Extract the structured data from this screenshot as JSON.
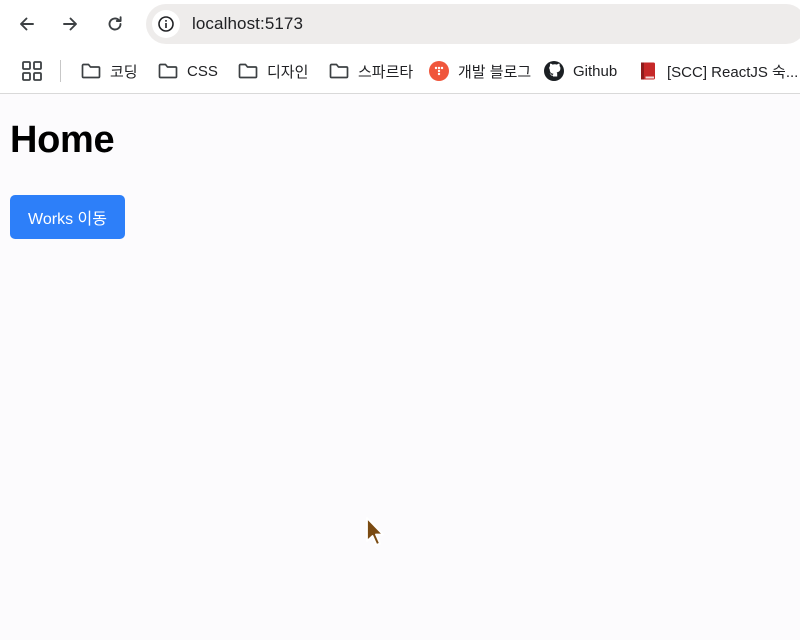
{
  "browser": {
    "url": "localhost:5173",
    "bookmarks": [
      {
        "label": "코딩",
        "icon": "folder-icon"
      },
      {
        "label": "CSS",
        "icon": "folder-icon"
      },
      {
        "label": "디자인",
        "icon": "folder-icon"
      },
      {
        "label": "스파르타",
        "icon": "folder-icon"
      },
      {
        "label": "개발 블로그",
        "icon": "blog-favicon-icon"
      },
      {
        "label": "Github",
        "icon": "github-icon"
      },
      {
        "label": "[SCC] ReactJS 숙...",
        "icon": "book-icon"
      }
    ]
  },
  "page": {
    "title": "Home",
    "button_label": "Works 이동",
    "accent_color": "#2d7ff9"
  }
}
